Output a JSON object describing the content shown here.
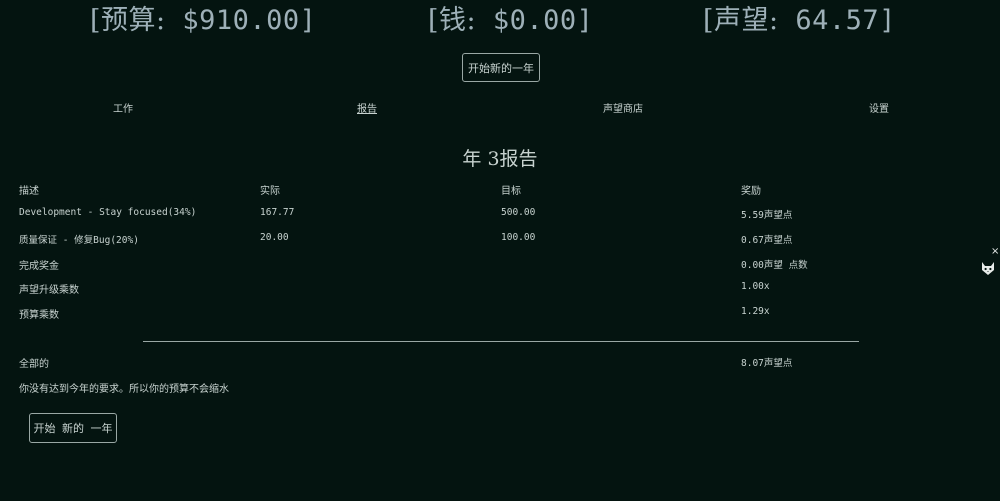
{
  "stats": {
    "budget_label": "[预算:",
    "budget_value": " $910.00]",
    "money_label": "[钱:",
    "money_value": " $0.00]",
    "reputation_label": "[声望:",
    "reputation_value": " 64.57]"
  },
  "top_button": "开始新的一年",
  "nav": {
    "work": "工作",
    "report": "报告",
    "shop": "声望商店",
    "settings": "设置"
  },
  "report": {
    "title": "年 3报告",
    "headers": [
      "描述",
      "实际",
      "目标",
      "奖励"
    ],
    "rows": [
      {
        "desc": "Development - Stay focused(34%)",
        "actual": "167.77",
        "target": "500.00",
        "reward": "5.59声望点"
      },
      {
        "desc": "质量保证 - 修复Bug(20%)",
        "actual": "20.00",
        "target": "100.00",
        "reward": "0.67声望点"
      },
      {
        "desc": "完成奖金",
        "actual": "",
        "target": "",
        "reward": "0.00声望 点数"
      },
      {
        "desc": "声望升级乘数",
        "actual": "",
        "target": "",
        "reward": "1.00x"
      },
      {
        "desc": "预算乘数",
        "actual": "",
        "target": "",
        "reward": "1.29x"
      }
    ],
    "total_label": "全部的",
    "total_value": "8.07声望点",
    "message": "你没有达到今年的要求。所以你的预算不会缩水"
  },
  "bottom_button": "开始 新的 一年",
  "side_widget": {
    "close": "×",
    "icon": "cat-icon"
  }
}
